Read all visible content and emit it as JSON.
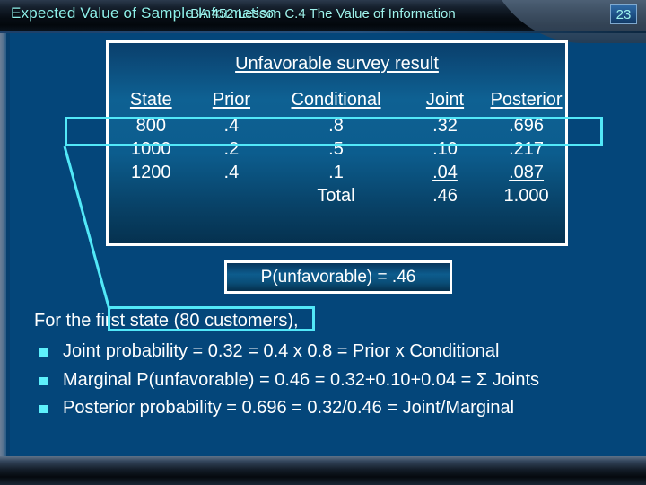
{
  "slide": {
    "title": "Expected Value of Sample Information",
    "background_color": "#04467a",
    "accent_color": "#52e8f8"
  },
  "table_panel": {
    "title": "Unfavorable survey result",
    "headers": [
      "State",
      "Prior",
      "Conditional",
      "Joint",
      "Posterior"
    ],
    "rows": [
      {
        "state": "800",
        "prior": ".4",
        "conditional": ".8",
        "joint": ".32",
        "posterior": ".696",
        "highlighted": true
      },
      {
        "state": "1000",
        "prior": ".2",
        "conditional": ".5",
        "joint": ".10",
        "posterior": ".217",
        "highlighted": false
      },
      {
        "state": "1200",
        "prior": ".4",
        "conditional": ".1",
        "joint": ".04",
        "posterior": ".087",
        "highlighted": false
      }
    ],
    "total_label": "Total",
    "total_joint": ".46",
    "total_posterior": "1.000"
  },
  "callout": {
    "probability_text": "P(unfavorable) = .46"
  },
  "body": {
    "lead": "For the first state (80 customers),",
    "lead_highlight_text": "first state (80 customers",
    "bullets": [
      "Joint probability = 0.32 = 0.4 x 0.8 = Prior x Conditional",
      "Marginal P(unfavorable) = 0.46 = 0.32+0.10+0.04 = Σ Joints",
      "Posterior probability = 0.696 = 0.32/0.46 = Joint/Marginal"
    ]
  },
  "footer": {
    "text": "BA 452  Lesson C.4 The Value of Information",
    "page_number": "23"
  }
}
